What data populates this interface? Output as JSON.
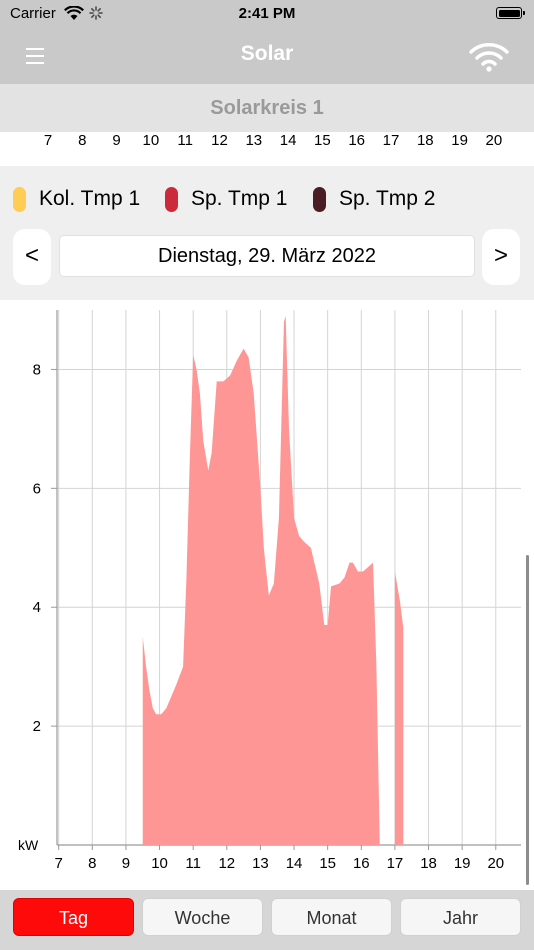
{
  "status": {
    "carrier": "Carrier",
    "time": "2:41 PM"
  },
  "nav": {
    "title": "Solar"
  },
  "section": {
    "title": "Solarkreis 1"
  },
  "legend": [
    {
      "label": "Kol. Tmp 1",
      "color": "#ffcc55"
    },
    {
      "label": "Sp. Tmp 1",
      "color": "#cc2a3a"
    },
    {
      "label": "Sp. Tmp 2",
      "color": "#4a1c24"
    }
  ],
  "date_nav": {
    "prev": "<",
    "date": "Dienstag, 29. März 2022",
    "next": ">"
  },
  "top_axis_hours": [
    "7",
    "8",
    "9",
    "10",
    "11",
    "12",
    "13",
    "14",
    "15",
    "16",
    "17",
    "18",
    "19",
    "20"
  ],
  "tabs": [
    {
      "label": "Tag",
      "active": true
    },
    {
      "label": "Woche",
      "active": false
    },
    {
      "label": "Monat",
      "active": false
    },
    {
      "label": "Jahr",
      "active": false
    }
  ],
  "chart_data": {
    "type": "area",
    "xlim": [
      6.95,
      20.75
    ],
    "ylim": [
      0,
      9
    ],
    "ylabel": "kW",
    "x_ticks": [
      7,
      8,
      9,
      10,
      11,
      12,
      13,
      14,
      15,
      16,
      17,
      18,
      19,
      20
    ],
    "x_tick_labels": [
      "7",
      "8",
      "9",
      "10",
      "11",
      "12",
      "13",
      "14",
      "15",
      "16",
      "17",
      "18",
      "19",
      "20"
    ],
    "y_ticks": [
      2,
      4,
      6,
      8
    ],
    "y_tick_labels": [
      "2",
      "4",
      "6",
      "8"
    ],
    "grid": true,
    "fill_color": "#ff9696",
    "series": [
      {
        "segments": [
          [
            [
              9.5,
              3.5
            ],
            [
              9.6,
              3.0
            ],
            [
              9.7,
              2.6
            ],
            [
              9.8,
              2.3
            ],
            [
              9.9,
              2.2
            ],
            [
              10.05,
              2.2
            ],
            [
              10.2,
              2.3
            ],
            [
              10.35,
              2.5
            ],
            [
              10.5,
              2.7
            ],
            [
              10.7,
              3.0
            ],
            [
              10.8,
              4.5
            ],
            [
              10.9,
              6.5
            ],
            [
              11.0,
              8.25
            ],
            [
              11.1,
              8.0
            ],
            [
              11.2,
              7.6
            ],
            [
              11.3,
              6.8
            ],
            [
              11.45,
              6.3
            ],
            [
              11.55,
              6.6
            ],
            [
              11.7,
              7.8
            ],
            [
              11.9,
              7.8
            ],
            [
              12.1,
              7.9
            ],
            [
              12.3,
              8.15
            ],
            [
              12.5,
              8.35
            ],
            [
              12.65,
              8.2
            ],
            [
              12.8,
              7.6
            ],
            [
              13.0,
              6.0
            ],
            [
              13.1,
              5.0
            ],
            [
              13.25,
              4.2
            ],
            [
              13.4,
              4.4
            ],
            [
              13.55,
              5.5
            ],
            [
              13.7,
              8.8
            ],
            [
              13.75,
              8.9
            ],
            [
              13.85,
              7.0
            ],
            [
              14.0,
              5.5
            ],
            [
              14.15,
              5.2
            ],
            [
              14.3,
              5.1
            ],
            [
              14.5,
              5.0
            ],
            [
              14.75,
              4.4
            ],
            [
              14.9,
              3.7
            ],
            [
              15.0,
              3.7
            ],
            [
              15.1,
              4.35
            ],
            [
              15.35,
              4.4
            ],
            [
              15.5,
              4.5
            ],
            [
              15.65,
              4.75
            ],
            [
              15.75,
              4.75
            ],
            [
              15.9,
              4.6
            ],
            [
              16.05,
              4.6
            ],
            [
              16.15,
              4.65
            ],
            [
              16.35,
              4.75
            ],
            [
              16.45,
              3.0
            ],
            [
              16.55,
              0.0
            ]
          ],
          [
            [
              17.0,
              4.6
            ],
            [
              17.15,
              4.1
            ],
            [
              17.25,
              3.65
            ]
          ]
        ]
      }
    ]
  }
}
